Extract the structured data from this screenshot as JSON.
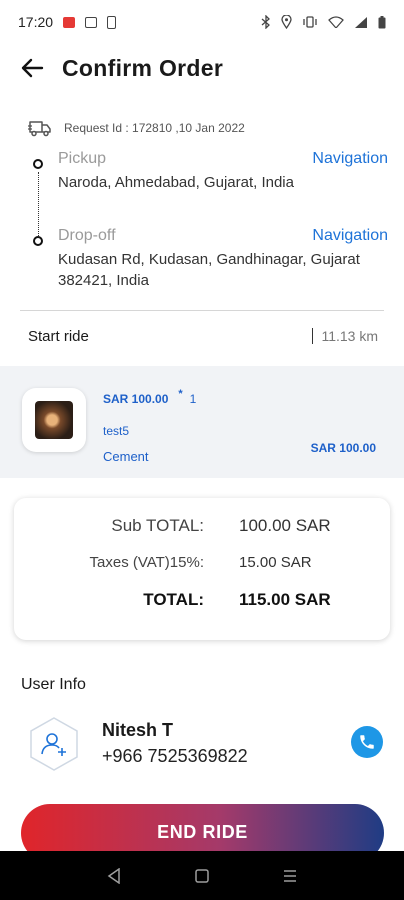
{
  "status_bar": {
    "time": "17:20"
  },
  "header": {
    "title": "Confirm Order"
  },
  "request": {
    "text": "Request Id : 172810 ,10 Jan 2022"
  },
  "pickup": {
    "label": "Pickup",
    "nav": "Navigation",
    "address": "Naroda, Ahmedabad, Gujarat, India"
  },
  "dropoff": {
    "label": "Drop-off",
    "nav": "Navigation",
    "address": "Kudasan Rd, Kudasan, Gandhinagar, Gujarat 382421, India"
  },
  "ride": {
    "label": "Start ride",
    "distance": "11.13 km"
  },
  "item": {
    "price": "SAR  100.00",
    "qty_mark": "*",
    "qty": "1",
    "name": "test5",
    "category": "Cement",
    "total": "SAR  100.00"
  },
  "summary": {
    "subtotal_label": "Sub TOTAL:",
    "subtotal_value": "100.00 SAR",
    "tax_label": "Taxes (VAT)15%:",
    "tax_value": "15.00 SAR",
    "total_label": "TOTAL:",
    "total_value": "115.00 SAR"
  },
  "user": {
    "section_title": "User Info",
    "name": "Nitesh T",
    "phone": "+966 7525369822"
  },
  "actions": {
    "end_ride": "END RIDE"
  },
  "colors": {
    "accent": "#1e73d8",
    "call": "#1e97e6",
    "gradient_start": "#e0252a",
    "gradient_end": "#1f3c84"
  },
  "icons": {
    "back": "arrow-left-icon",
    "truck": "truck-icon",
    "user": "add-user-icon",
    "call": "phone-icon",
    "nav_back": "triangle-back-icon",
    "nav_home": "square-home-icon",
    "nav_menu": "menu-lines-icon"
  }
}
